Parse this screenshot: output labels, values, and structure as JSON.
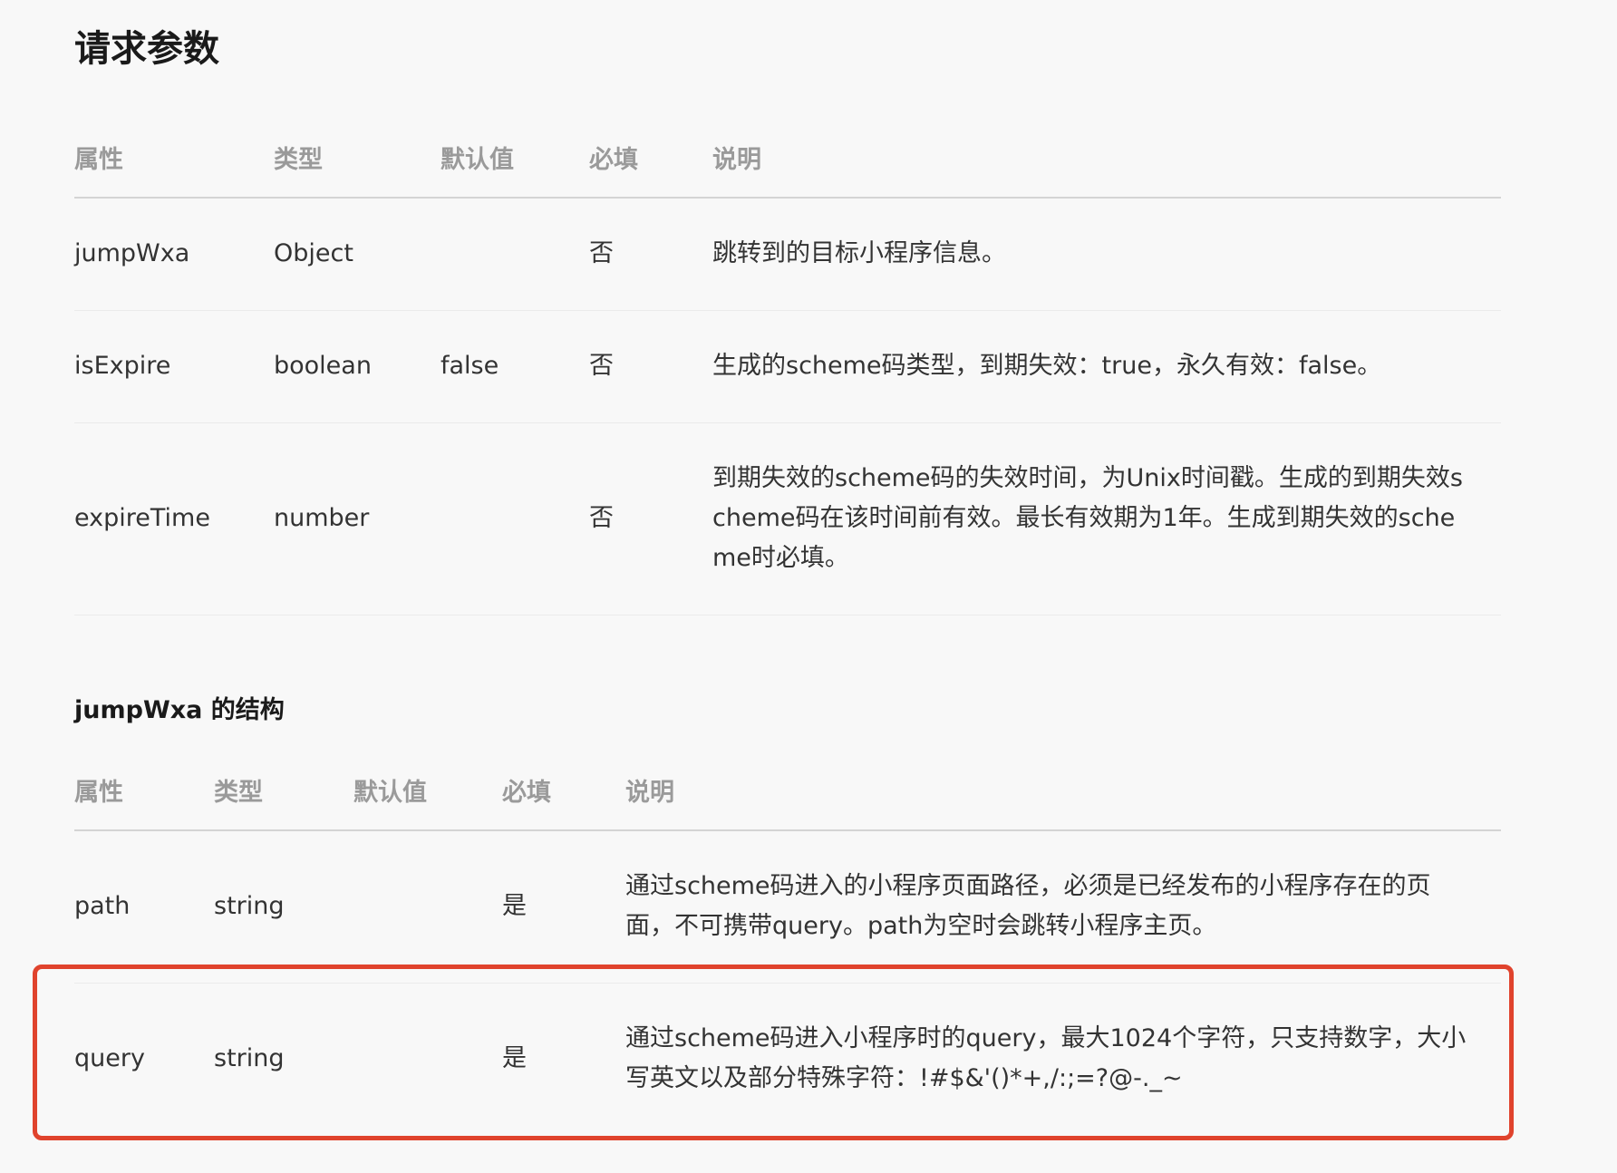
{
  "section_title": "请求参数",
  "table1": {
    "headers": [
      "属性",
      "类型",
      "默认值",
      "必填",
      "说明"
    ],
    "rows": [
      [
        "jumpWxa",
        "Object",
        "",
        "否",
        "跳转到的目标小程序信息。"
      ],
      [
        "isExpire",
        "boolean",
        "false",
        "否",
        "生成的scheme码类型，到期失效：true，永久有效：false。"
      ],
      [
        "expireTime",
        "number",
        "",
        "否",
        "到期失效的scheme码的失效时间，为Unix时间戳。生成的到期失效scheme码在该时间前有效。最长有效期为1年。生成到期失效的scheme时必填。"
      ]
    ]
  },
  "sub_title": "jumpWxa 的结构",
  "table2": {
    "headers": [
      "属性",
      "类型",
      "默认值",
      "必填",
      "说明"
    ],
    "rows": [
      [
        "path",
        "string",
        "",
        "是",
        "通过scheme码进入的小程序页面路径，必须是已经发布的小程序存在的页面，不可携带query。path为空时会跳转小程序主页。"
      ],
      [
        "query",
        "string",
        "",
        "是",
        "通过scheme码进入小程序时的query，最大1024个字符，只支持数字，大小写英文以及部分特殊字符：!#$&'()*+,/:;=?@-._~"
      ]
    ]
  },
  "colors": {
    "highlight": "#e0432d",
    "header_text": "#9a9a9a",
    "body_text": "#333333"
  }
}
